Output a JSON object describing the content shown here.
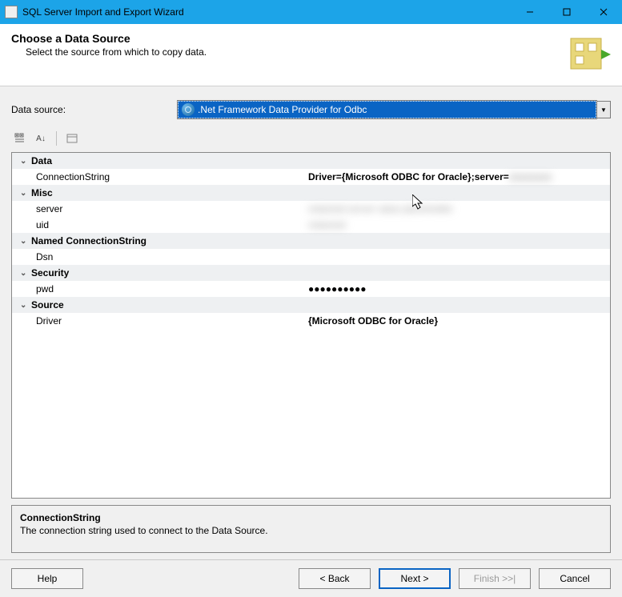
{
  "window": {
    "title": "SQL Server Import and Export Wizard"
  },
  "header": {
    "title": "Choose a Data Source",
    "subtitle": "Select the source from which to copy data."
  },
  "source": {
    "label": "Data source:",
    "selected": ".Net Framework Data Provider for Odbc"
  },
  "grid": {
    "categories": [
      {
        "name": "Data",
        "properties": [
          {
            "name": "ConnectionString",
            "value": "Driver={Microsoft ODBC for Oracle};server=",
            "bold": true,
            "blurTail": true
          }
        ]
      },
      {
        "name": "Misc",
        "properties": [
          {
            "name": "server",
            "value": "redacted server value placeholder",
            "blurred": true
          },
          {
            "name": "uid",
            "value": "redacted",
            "blurred": true
          }
        ]
      },
      {
        "name": "Named ConnectionString",
        "properties": [
          {
            "name": "Dsn",
            "value": ""
          }
        ]
      },
      {
        "name": "Security",
        "properties": [
          {
            "name": "pwd",
            "value": "●●●●●●●●●●",
            "bold": true
          }
        ]
      },
      {
        "name": "Source",
        "properties": [
          {
            "name": "Driver",
            "value": "{Microsoft ODBC for Oracle}",
            "bold": true
          }
        ]
      }
    ]
  },
  "help_panel": {
    "title": "ConnectionString",
    "text": "The connection string used to connect to the Data Source."
  },
  "footer": {
    "help": "Help",
    "back": "< Back",
    "next": "Next >",
    "finish": "Finish >>|",
    "cancel": "Cancel"
  }
}
